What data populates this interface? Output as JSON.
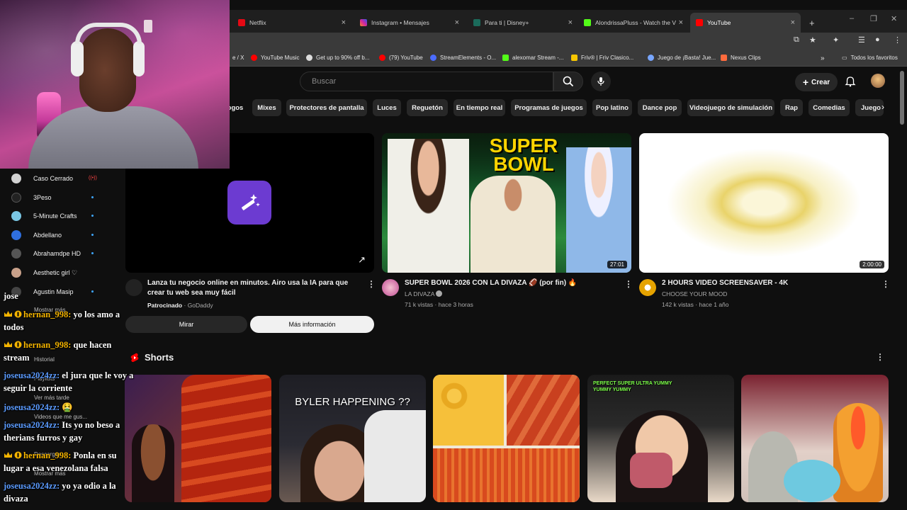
{
  "browser": {
    "tabs": [
      {
        "title": "Netflix",
        "color": "#e50914"
      },
      {
        "title": "Instagram • Mensajes",
        "color": "#d6249f"
      },
      {
        "title": "Para ti | Disney+",
        "color": "#1b6b5b"
      },
      {
        "title": "AlondrissaPluss - Watch the VC",
        "color": "#53fc18"
      },
      {
        "title": "YouTube",
        "color": "#ff0000"
      }
    ],
    "new_tab": "+",
    "bookmarks": [
      {
        "label": "e / X",
        "color": "#ffffff"
      },
      {
        "label": "YouTube Music",
        "color": "#ff0000"
      },
      {
        "label": "Get up to 90% off b...",
        "color": "#dddddd"
      },
      {
        "label": "(79) YouTube",
        "color": "#ff0000"
      },
      {
        "label": "StreamElements - O...",
        "color": "#4b6cff"
      },
      {
        "label": "alexomar Stream -...",
        "color": "#53fc18"
      },
      {
        "label": "Friv® | Friv Clasico...",
        "color": "#f7c600"
      },
      {
        "label": "Juego de ¡Basta! Jue...",
        "color": "#78a6ff"
      },
      {
        "label": "Nexus Clips",
        "color": "#ff6b3d"
      }
    ],
    "bookmarks_more": "»",
    "all_bookmarks": "Todos los favoritos"
  },
  "youtube": {
    "search_placeholder": "Buscar",
    "create_label": "Crear",
    "chips": [
      "ogos",
      "Mixes",
      "Protectores de pantalla",
      "Luces",
      "Reguetón",
      "En tiempo real",
      "Programas de juegos",
      "Pop latino",
      "Dance pop",
      "Videojuego de simulación",
      "Rap",
      "Comedias",
      "Juego"
    ],
    "ad": {
      "title_line1": "Lanza tu negocio online en minutos. Airo usa la IA para que",
      "title_line2": "crear tu web sea muy fácil",
      "sponsored": "Patrocinado",
      "advertiser": "· GoDaddy",
      "watch_label": "Mirar",
      "more_info_label": "Más información",
      "link_arrow": "↗"
    },
    "videos": [
      {
        "title": "SUPER BOWL 2026 CON LA DIVAZA 🏈 (por fin) 🔥",
        "channel": "LA DIVAZA",
        "meta": "71 k vistas · hace 3 horas",
        "duration": "27:01",
        "thumb_text": "SUPER BOWL"
      },
      {
        "title": "2 HOURS VIDEO SCREENSAVER - 4K",
        "channel": "CHOOSE YOUR MOOD",
        "meta": "142 k vistas · hace 1 año",
        "duration": "2:00:00"
      }
    ],
    "shorts_title": "Shorts",
    "shorts": [
      {
        "text": ""
      },
      {
        "text": "BYLER HAPPENING ??"
      },
      {
        "text": ""
      },
      {
        "text": "PERFECT SUPER ULTRA YUMMY YUMMY YUMMY"
      },
      {
        "text": ""
      }
    ]
  },
  "sidebar": {
    "subs": [
      {
        "label": "Caso Cerrado",
        "indicator": "live",
        "live_icon": "((•))",
        "color": "#d2d2d2"
      },
      {
        "label": "3Peso",
        "indicator": "dot",
        "color": "#222222"
      },
      {
        "label": "5-Minute Crafts",
        "indicator": "dot",
        "color": "#7ac7e4"
      },
      {
        "label": "Abdellano",
        "indicator": "dot",
        "color": "#2f6fe0"
      },
      {
        "label": "Abrahamdpe HD",
        "indicator": "dot",
        "color": "#555555"
      },
      {
        "label": "Aesthetic girl ♡",
        "indicator": "none",
        "color": "#c9a18a"
      },
      {
        "label": "Agustin Masip",
        "indicator": "dot",
        "color": "#444444"
      }
    ],
    "show_more": "Mostrar más",
    "you_items": [
      "Historial",
      "Playlists",
      "Ver más tarde",
      "Videos que me gus...",
      "Descargas",
      "Mostrar más"
    ]
  },
  "chat": [
    {
      "user": "",
      "text": "jose"
    },
    {
      "user": "hernan_998:",
      "text": "yo los amo a",
      "badges": true,
      "cls": "u1"
    },
    {
      "user": "",
      "text": "todos"
    },
    {
      "user": "hernan_998:",
      "text": "que hacen",
      "badges": true,
      "cls": "u1"
    },
    {
      "user": "",
      "text": "stream"
    },
    {
      "user": "joseusa2024zz:",
      "text": "el jura que le voy a",
      "cls": "u2"
    },
    {
      "user": "",
      "text": "seguir la corriente"
    },
    {
      "user": "joseusa2024zz:",
      "text": "🤮",
      "cls": "u2"
    },
    {
      "user": "joseusa2024zz:",
      "text": "Its yo no beso a",
      "cls": "u2"
    },
    {
      "user": "",
      "text": "therians furros y gay"
    },
    {
      "user": "hernan_998:",
      "text": "Ponla en su",
      "badges": true,
      "cls": "u1"
    },
    {
      "user": "",
      "text": "lugar a esa venezolana falsa"
    },
    {
      "user": "joseusa2024zz:",
      "text": "yo ya odio a la",
      "cls": "u2"
    },
    {
      "user": "",
      "text": "divaza"
    }
  ],
  "colors": {
    "accent_red": "#ff0000",
    "bg": "#0f0f0f",
    "chip_bg": "#272727"
  }
}
